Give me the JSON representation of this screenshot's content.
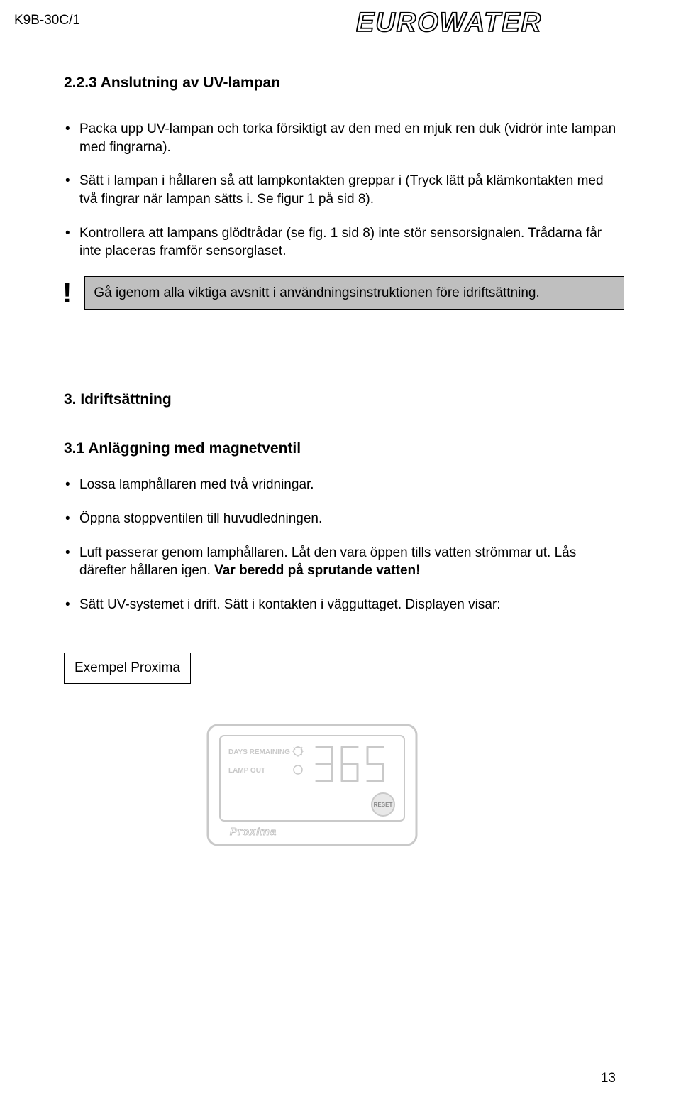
{
  "header": {
    "doc_id": "K9B-30C/1",
    "brand": "EUROWATER"
  },
  "section_223": {
    "title": "2.2.3  Anslutning av UV-lampan",
    "bullet1": "Packa upp UV-lampan och torka försiktigt av den med en mjuk ren duk (vidrör inte lampan med fingrarna).",
    "bullet2": "Sätt i lampan i hållaren så att lampkontakten greppar i (Tryck lätt på klämkontakten med två fingrar när lampan sätts i. Se figur 1 på sid 8).",
    "bullet3": "Kontrollera att lampans glödtrådar (se fig. 1 sid 8) inte stör sensorsignalen. Trådarna får inte placeras framför sensorglaset.",
    "callout": "Gå igenom alla viktiga avsnitt i användningsinstruktionen före idriftsättning."
  },
  "section_3": {
    "title": "3.  Idriftsättning"
  },
  "section_31": {
    "title": "3.1  Anläggning med magnetventil",
    "bullet1": "Lossa lamphållaren med två vridningar.",
    "bullet2": "Öppna stoppventilen till huvudledningen.",
    "bullet3a": "Luft passerar genom lamphållaren. Låt den vara öppen tills vatten strömmar ut. Lås därefter hållaren igen. ",
    "bullet3b": "Var beredd på sprutande vatten!",
    "bullet4": "Sätt UV-systemet i drift. Sätt i kontakten i vägguttaget. Displayen visar:",
    "example_label": "Exempel Proxima"
  },
  "device": {
    "label_days": "DAYS REMAINING",
    "label_lamp": "LAMP OUT",
    "digits": "365",
    "reset": "RESET",
    "brand": "Proxima"
  },
  "footer": {
    "page": "13"
  }
}
